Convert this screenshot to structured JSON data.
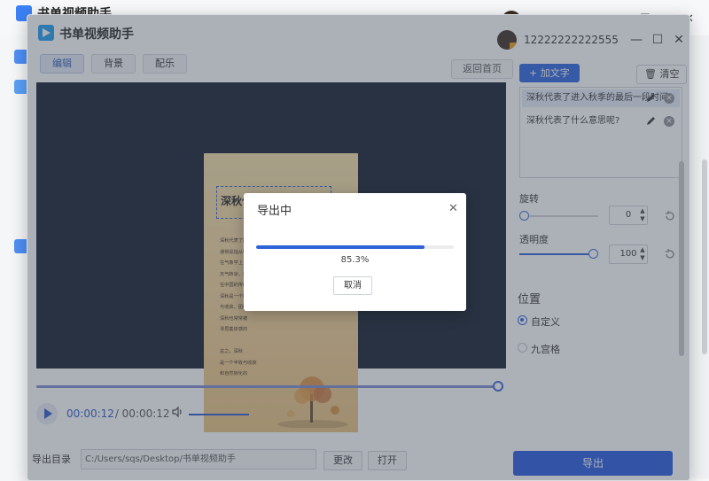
{
  "background_app": {
    "title": "书单视频助手",
    "phone": "12222222222555"
  },
  "window": {
    "title": "书单视频助手",
    "phone": "12222222222555",
    "controls": {
      "minimize": "—",
      "maximize": "☐",
      "close": "✕"
    }
  },
  "tabs": [
    {
      "label": "编辑",
      "active": true
    },
    {
      "label": "背景",
      "active": false
    },
    {
      "label": "配乐",
      "active": false
    }
  ],
  "back_home_label": "返回首页",
  "preview": {
    "poster_title": "深秋代表了什么意思呢?",
    "poster_lines": [
      "深秋代表了比入秋的最后一段时间，",
      "通常是指从秋分到霜降这个时节的阶段。",
      "在气象学上，深秋通常气温逐渐降低，",
      "天气转凉，白",
      "在中国的传统",
      "深秋是一个收",
      "与收获、团圆",
      "深秋也常常被",
      "寻思集体感的",
      "",
      "总之，深秋",
      "是一个丰收与收获",
      "和自然转化的"
    ]
  },
  "player": {
    "time_current": "00:00:12",
    "time_separator": " / ",
    "time_total": "00:00:12",
    "progress": 1.0,
    "volume": 1.0
  },
  "export": {
    "dir_label": "导出目录",
    "path": "C:/Users/sqs/Desktop/书单视频助手",
    "change_label": "更改",
    "open_label": "打开",
    "export_label": "导出"
  },
  "right_panel": {
    "add_text_label": "+ 加文字",
    "clear_label": "清空",
    "text_items": [
      {
        "label": "深秋代表了进入秋季的最后一段时间",
        "selected": true
      },
      {
        "label": "深秋代表了什么意思呢?",
        "selected": false
      }
    ],
    "rotation": {
      "label": "旋转",
      "value": "0",
      "level": 0.0
    },
    "opacity": {
      "label": "透明度",
      "value": "100",
      "level": 1.0
    },
    "position": {
      "heading": "位置",
      "options": [
        {
          "label": "自定义",
          "checked": true
        },
        {
          "label": "九宫格",
          "checked": false
        }
      ]
    }
  },
  "dialog": {
    "title": "导出中",
    "close": "✕",
    "progress": 0.853,
    "percent_text": "85.3%",
    "cancel_label": "取消"
  },
  "colors": {
    "accent": "#2358e0",
    "preview_bg": "#0f1b2b",
    "dim_overlay": "rgba(70,80,95,0.45)"
  }
}
